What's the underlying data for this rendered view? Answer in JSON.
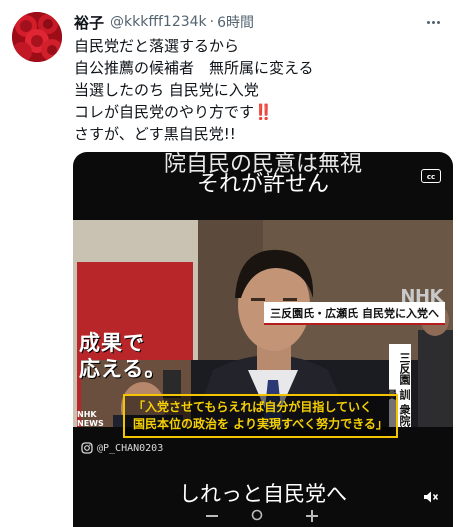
{
  "tweet": {
    "display_name": "裕子",
    "handle": "@kkkfff1234k",
    "separator": "·",
    "time": "6時間",
    "lines": [
      "自民党だと落選するから",
      "自公推薦の候補者　無所属に変える",
      "当選したのち 自民党に入党",
      "コレが自民党のやり方です",
      "さすが、どす黒自民党!!"
    ],
    "exclamation_emoji": "‼️"
  },
  "video": {
    "caption_top_1": "院自民の民意は無視",
    "caption_top_2": "それが許せん",
    "cc_label": "cc",
    "nhk_logo": "NHK",
    "headline": "三反園氏・広瀬氏 自民党に入党へ",
    "name_card": "三反園 訓 衆院議員",
    "poster_text_1": "成果で",
    "poster_text_2": "応える。",
    "subtitle_line_1": "「入党させてもらえれば自分が目指していく",
    "subtitle_line_2": "国民本位の政治を より実現すべく努力できる」",
    "nhk_news_1": "NHK",
    "nhk_news_2": "NEWS",
    "watermark": "@P_CHAN0203",
    "caption_bottom": "しれっと自民党へ"
  },
  "icons": [
    "more-icon",
    "avatar-rose-image",
    "closed-captions-icon",
    "instagram-icon",
    "mute-icon"
  ],
  "colors": {
    "name": "#0f1419",
    "secondary": "#536471",
    "subtitle": "#f6d000",
    "headline_bar": "#b51c1c",
    "emoji_red": "#e0212b"
  }
}
